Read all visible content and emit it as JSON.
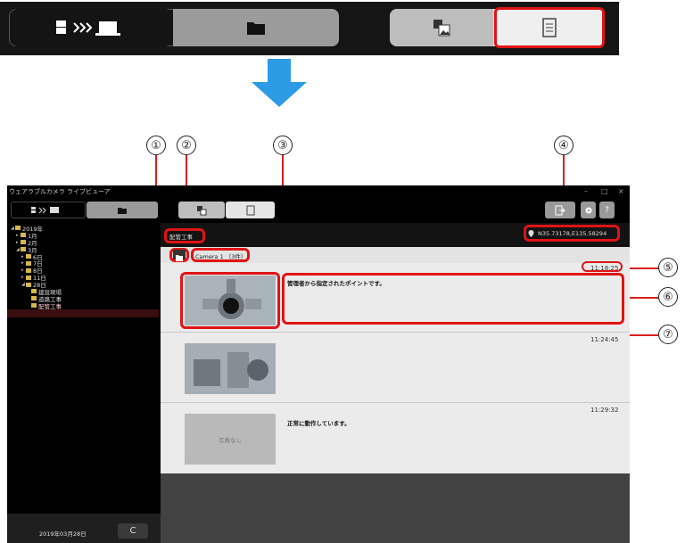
{
  "toolbar_top": {
    "tabs": [
      {
        "name": "transfer",
        "icon": "camera-to-pc-icon"
      },
      {
        "name": "folder",
        "icon": "folder-icon"
      },
      {
        "name": "photo-view",
        "icon": "film-photo-icon"
      },
      {
        "name": "report-view",
        "icon": "document-icon"
      }
    ]
  },
  "callouts": [
    "①",
    "②",
    "③",
    "④",
    "⑤",
    "⑥",
    "⑦"
  ],
  "window": {
    "title": "ウェアラブルカメラ ライブビューア",
    "controls": [
      "–",
      "□",
      "×"
    ]
  },
  "tree": {
    "items": [
      {
        "label": "2019年",
        "level": 0,
        "arrow": "◢"
      },
      {
        "label": "1月",
        "level": 1,
        "arrow": "▸"
      },
      {
        "label": "2月",
        "level": 1,
        "arrow": "▸"
      },
      {
        "label": "3月",
        "level": 1,
        "arrow": "◢"
      },
      {
        "label": "6日",
        "level": 2,
        "arrow": "▸"
      },
      {
        "label": "7日",
        "level": 2,
        "arrow": "▸"
      },
      {
        "label": "8日",
        "level": 2,
        "arrow": "▸"
      },
      {
        "label": "11日",
        "level": 2,
        "arrow": "▸"
      },
      {
        "label": "28日",
        "level": 2,
        "arrow": "◢"
      },
      {
        "label": "建設現場",
        "level": 3,
        "arrow": ""
      },
      {
        "label": "道路工事",
        "level": 3,
        "arrow": ""
      },
      {
        "label": "配管工事",
        "level": 3,
        "arrow": ""
      }
    ]
  },
  "header": {
    "project": "配管工事",
    "location": "N35.73178,E135.58294"
  },
  "subbar": {
    "camera": "Camera 1 （3件）"
  },
  "entries": [
    {
      "time": "11:18:25",
      "text": "管理者から指定されたポイントです。",
      "has_photo": true
    },
    {
      "time": "11:24:45",
      "text": "",
      "has_photo": true
    },
    {
      "time": "11:29:32",
      "text": "正常に動作しています。",
      "has_photo": false,
      "no_photo_label": "写真なし"
    }
  ],
  "footer": {
    "date": "2019年03月28日",
    "refresh": "C"
  }
}
